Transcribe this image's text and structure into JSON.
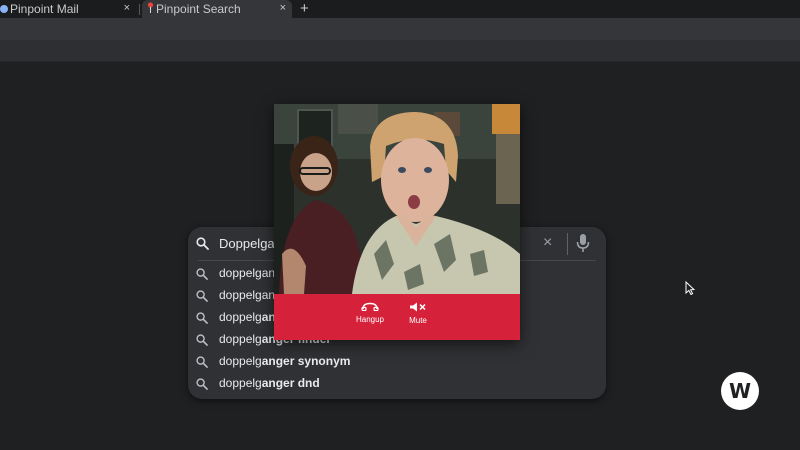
{
  "browser": {
    "tabs": [
      {
        "title": "Pinpoint Mail",
        "close": "×"
      },
      {
        "title": "Pinpoint Search",
        "close": "×"
      }
    ],
    "new_tab_label": "+"
  },
  "search": {
    "query": "Doppelgan",
    "clear_label": "×",
    "suggestions": [
      {
        "prefix": "doppelgang",
        "bold": ""
      },
      {
        "prefix": "doppelgang",
        "bold": ""
      },
      {
        "prefix": "doppelg",
        "bold": "ang"
      },
      {
        "prefix": "doppelg",
        "bold": "anger finder"
      },
      {
        "prefix": "doppelg",
        "bold": "anger synonym"
      },
      {
        "prefix": "doppelg",
        "bold": "anger dnd"
      }
    ]
  },
  "call": {
    "hangup_label": "Hangup",
    "mute_label": "Mute",
    "controls_color": "#d5213a"
  },
  "watermark": {
    "letter": "W"
  },
  "icons": [
    "mail-icon",
    "pin-icon",
    "search-icon",
    "clear-icon",
    "mic-icon",
    "hangup-icon",
    "mute-icon",
    "cursor-icon"
  ]
}
